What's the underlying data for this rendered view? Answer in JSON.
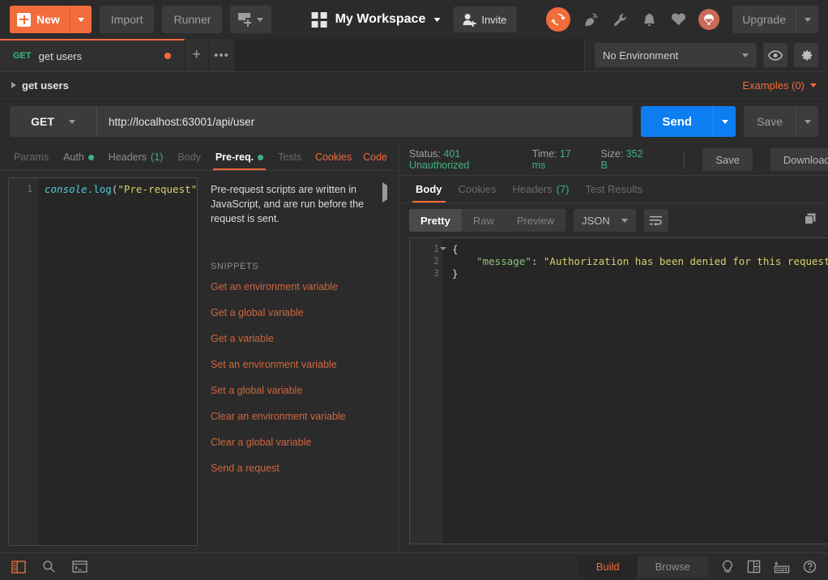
{
  "topbar": {
    "new_label": "New",
    "new_icon": "plus-square-icon",
    "import_label": "Import",
    "runner_label": "Runner",
    "collection_icon": "new-collection-icon",
    "workspace_grid_icon": "grid-icon",
    "workspace_name": "My Workspace",
    "invite_label": "Invite",
    "invite_icon": "person-plus-icon",
    "sync_icon": "sync-refresh-icon",
    "satellite_icon": "satellite-dish-icon",
    "wrench_icon": "wrench-icon",
    "bell_icon": "bell-icon",
    "heart_icon": "heart-icon",
    "balloon_icon": "parachute-balloon-icon",
    "upgrade_label": "Upgrade"
  },
  "tabs": {
    "request_tab": {
      "method": "GET",
      "name": "get users",
      "unsaved_dot": true
    },
    "add_tab_icon": "plus-icon",
    "more_tabs_icon": "ellipsis-icon",
    "environment_selected": "No Environment",
    "eye_icon": "eye-icon",
    "gear_icon": "gear-icon"
  },
  "breadcrumb": {
    "label": "get users",
    "examples_label": "Examples (0)"
  },
  "url": {
    "method": "GET",
    "value": "http://localhost:63001/api/user",
    "send_label": "Send",
    "save_label": "Save"
  },
  "request_tabs": {
    "items": [
      {
        "label": "Params",
        "state": "dim",
        "dot": false,
        "count": ""
      },
      {
        "label": "Auth",
        "state": "normal",
        "dot": true,
        "count": ""
      },
      {
        "label": "Headers",
        "state": "normal",
        "dot": false,
        "count": "(1)"
      },
      {
        "label": "Body",
        "state": "dim",
        "dot": false,
        "count": ""
      },
      {
        "label": "Pre-req.",
        "state": "active",
        "dot": true,
        "count": ""
      },
      {
        "label": "Tests",
        "state": "dim",
        "dot": false,
        "count": ""
      }
    ],
    "cookies_label": "Cookies",
    "code_label": "Code"
  },
  "editor": {
    "line_number": "1",
    "code": {
      "class_token": "console",
      "method_token": ".log",
      "open_paren": "(",
      "string_token": "\"Pre-request\"",
      "close": ");"
    }
  },
  "help": {
    "description": "Pre-request scripts are written in JavaScript, and are run before the request is sent.",
    "collapse_icon": "chevron-right-icon",
    "snippets_title": "SNIPPETS",
    "snippets": [
      "Get an environment variable",
      "Get a global variable",
      "Get a variable",
      "Set an environment variable",
      "Set a global variable",
      "Clear an environment variable",
      "Clear a global variable",
      "Send a request"
    ]
  },
  "response": {
    "status_label": "Status:",
    "status_value": "401 Unauthorized",
    "time_label": "Time:",
    "time_value": "17 ms",
    "size_label": "Size:",
    "size_value": "352 B",
    "save_label": "Save",
    "download_label": "Download",
    "tabs": [
      {
        "label": "Body",
        "state": "active",
        "count": ""
      },
      {
        "label": "Cookies",
        "state": "dim",
        "count": ""
      },
      {
        "label": "Headers",
        "state": "dim",
        "count": "(7)"
      },
      {
        "label": "Test Results",
        "state": "dim",
        "count": ""
      }
    ],
    "view_modes": [
      {
        "label": "Pretty",
        "active": true
      },
      {
        "label": "Raw",
        "active": false
      },
      {
        "label": "Preview",
        "active": false
      }
    ],
    "format": "JSON",
    "wrap_icon": "word-wrap-icon",
    "copy_icon": "copy-icon",
    "search_icon": "search-icon",
    "body_lines": [
      {
        "num": "1",
        "fold": true,
        "content_brace": "{"
      },
      {
        "num": "2",
        "fold": false,
        "indent": "    ",
        "key": "\"message\"",
        "colon": ": ",
        "value": "\"Authorization has been denied for this request.\""
      },
      {
        "num": "3",
        "fold": false,
        "content_brace": "}"
      }
    ]
  },
  "statusbar": {
    "sidebar_toggle_icon": "sidebar-toggle-icon",
    "find_icon": "search-icon",
    "console_icon": "console-terminal-icon",
    "build_label": "Build",
    "browse_label": "Browse",
    "bulb_icon": "lightbulb-icon",
    "layout_icon": "two-pane-layout-icon",
    "keyboard_icon": "keyboard-icon",
    "help_icon": "help-circle-icon"
  },
  "colors": {
    "accent_orange": "#f26b3a",
    "send_blue": "#0c7ef2",
    "status_green": "#3fb380",
    "bg": "#2b2b2b"
  }
}
